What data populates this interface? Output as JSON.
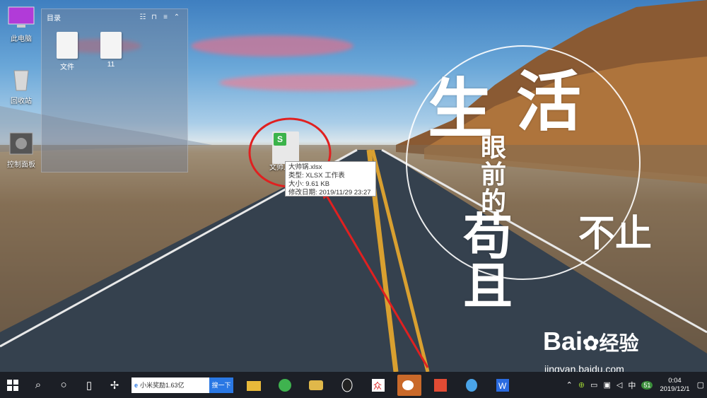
{
  "desktop_icons": [
    {
      "label": "此电脑",
      "icon": "computer-icon"
    },
    {
      "label": "回收站",
      "icon": "recycle-bin-icon"
    },
    {
      "label": "控制面板",
      "icon": "control-panel-icon"
    }
  ],
  "folder_panel": {
    "title": "目录",
    "items": [
      {
        "label": "文件",
        "icon": "document-file-icon"
      },
      {
        "label": "11",
        "icon": "word-file-icon"
      }
    ]
  },
  "spreadsheet": {
    "label": "文帅...",
    "icon": "spreadsheet-icon"
  },
  "tooltip": {
    "name": "大帅锅.xlsx",
    "type": "类型: XLSX 工作表",
    "size": "大小: 9.61 KB",
    "modified": "修改日期: 2019/11/29 23:27"
  },
  "wallpaper_text": {
    "line1": "生",
    "line2": "活",
    "line3": "眼前的",
    "line4": "苟且",
    "line5": "不止"
  },
  "watermark": {
    "brand": "Bai",
    "brand2": "经验",
    "url": "jingyan.baidu.com"
  },
  "taskbar": {
    "search_text": "小米奖励1.63亿",
    "search_button": "搜一下",
    "ime": "中",
    "badge": "51",
    "time": "0:04",
    "date": "2019/12/1"
  },
  "colors": {
    "taskbar": "#1c1f26",
    "accent_blue": "#2a78e4",
    "annotation_red": "#e02020"
  }
}
